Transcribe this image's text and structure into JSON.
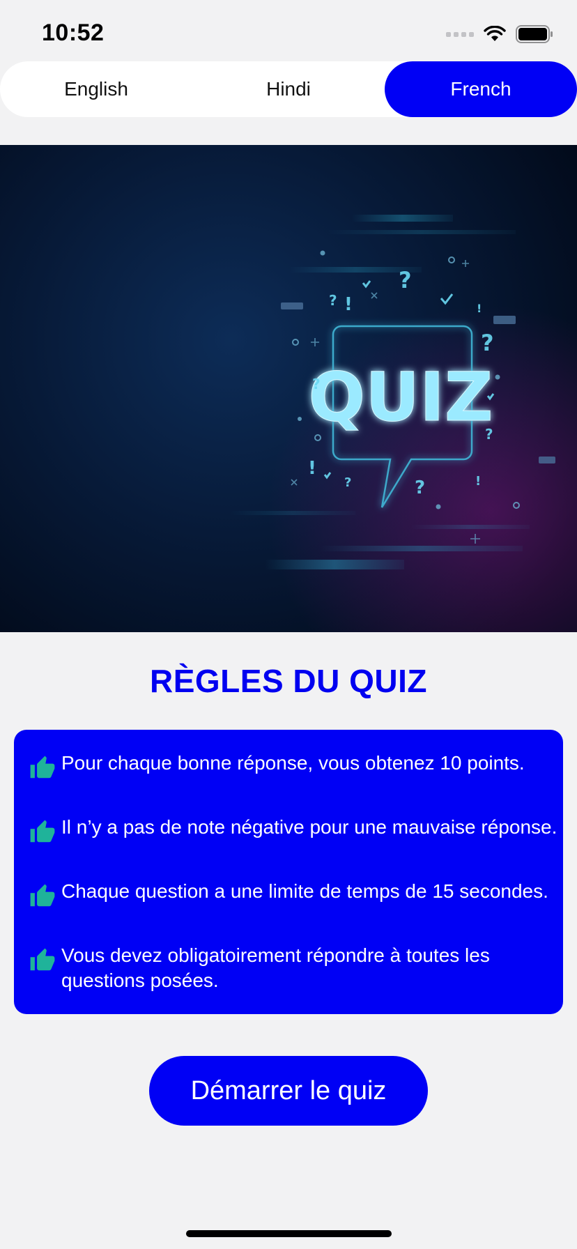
{
  "status_bar": {
    "time": "10:52"
  },
  "language_tabs": [
    {
      "label": "English",
      "selected": false
    },
    {
      "label": "Hindi",
      "selected": false
    },
    {
      "label": "French",
      "selected": true
    }
  ],
  "banner": {
    "text": "QUIZ"
  },
  "rules": {
    "title": "RÈGLES DU QUIZ",
    "items": [
      {
        "icon": "thumbs-up-icon",
        "text": "Pour chaque bonne réponse, vous obtenez 10 points."
      },
      {
        "icon": "thumbs-up-icon",
        "text": "Il n’y a pas de note négative pour une mauvaise réponse."
      },
      {
        "icon": "thumbs-up-icon",
        "text": "Chaque question a une limite de temps de 15 secondes."
      },
      {
        "icon": "thumbs-up-icon",
        "text": "Vous devez obligatoirement répondre à toutes les questions posées."
      }
    ]
  },
  "start_button": {
    "label": "Démarrer le quiz"
  },
  "colors": {
    "accent": "#0000f5",
    "thumb_icon": "#1fb39a",
    "background": "#f2f2f3"
  }
}
